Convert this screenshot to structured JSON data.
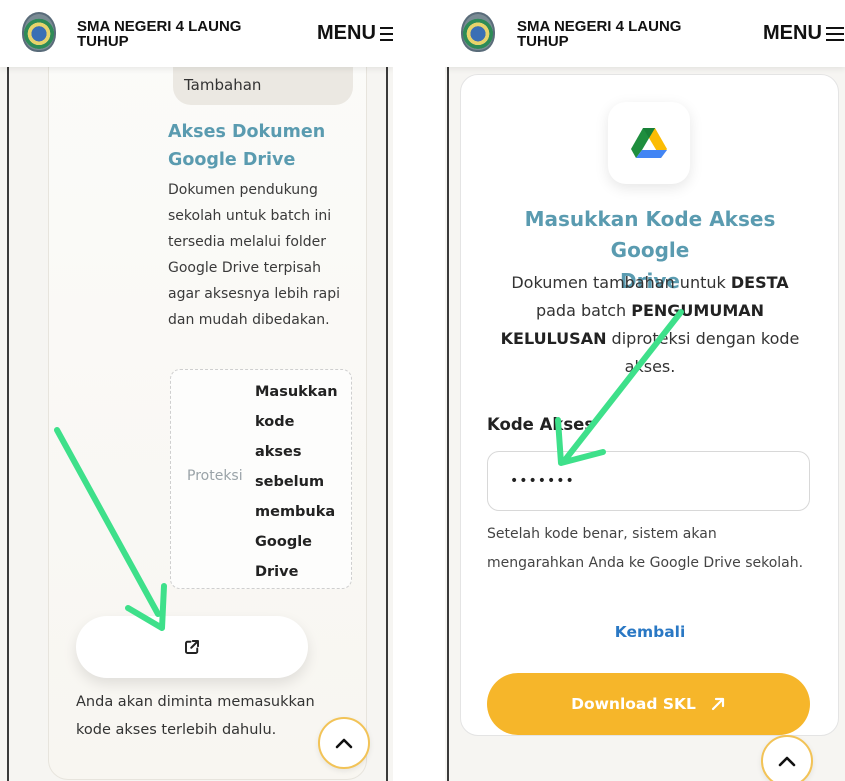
{
  "colors": {
    "accent_teal": "#5a9bb0",
    "link_blue": "#2a78c4",
    "download_yellow": "#f6b62a",
    "annotation_arrow": "#3ee08a"
  },
  "left_screen": {
    "header": {
      "school_name_line1": "SMA NEGERI 4 LAUNG",
      "school_name_line2": "TUHUP",
      "menu_label": "MENU",
      "menu_icon": "hamburger-icon",
      "logo_icon": "school-emblem-logo"
    },
    "tag_label": "Tambahan",
    "title_line1": "Akses Dokumen",
    "title_line2": "Google Drive",
    "description_lines": [
      "Dokumen pendukung",
      "sekolah untuk batch ini",
      "tersedia melalui folder",
      "Google Drive terpisah",
      "agar aksesnya lebih rapi",
      "dan mudah dibedakan."
    ],
    "protection": {
      "label": "Proteksi",
      "value_lines": [
        "Masukkan",
        "kode",
        "akses",
        "sebelum",
        "membuka",
        "Google",
        "Drive"
      ]
    },
    "open_button_icon": "external-link-icon",
    "note_line1": "Anda akan diminta memasukkan",
    "note_line2": "kode akses terlebih dahulu.",
    "scroll_top_icon": "chevron-up-icon"
  },
  "right_screen": {
    "header": {
      "school_name_line1": "SMA NEGERI 4 LAUNG",
      "school_name_line2": "TUHUP",
      "menu_label": "MENU",
      "menu_icon": "hamburger-icon",
      "logo_icon": "school-emblem-logo"
    },
    "drive_icon": "google-drive-icon",
    "title_line1": "Masukkan Kode Akses Google",
    "title_line2": "Drive",
    "description": {
      "line1_prefix": "Dokumen tambahan untuk ",
      "line1_bold": "DESTA",
      "line2_prefix": "pada batch ",
      "line2_bold": "PENGUMUMAN",
      "line3_bold": "KELULUSAN",
      "line3_suffix": " diproteksi dengan kode",
      "line4": "akses."
    },
    "code_label": "Kode Akses",
    "code_value": "•••••••",
    "hint_line1": "Setelah kode benar, sistem akan",
    "hint_line2": "mengarahkan Anda ke Google Drive sekolah.",
    "back_link": "Kembali",
    "download_label": "Download SKL",
    "download_icon": "arrow-up-right-icon",
    "scroll_top_icon": "chevron-up-icon"
  }
}
